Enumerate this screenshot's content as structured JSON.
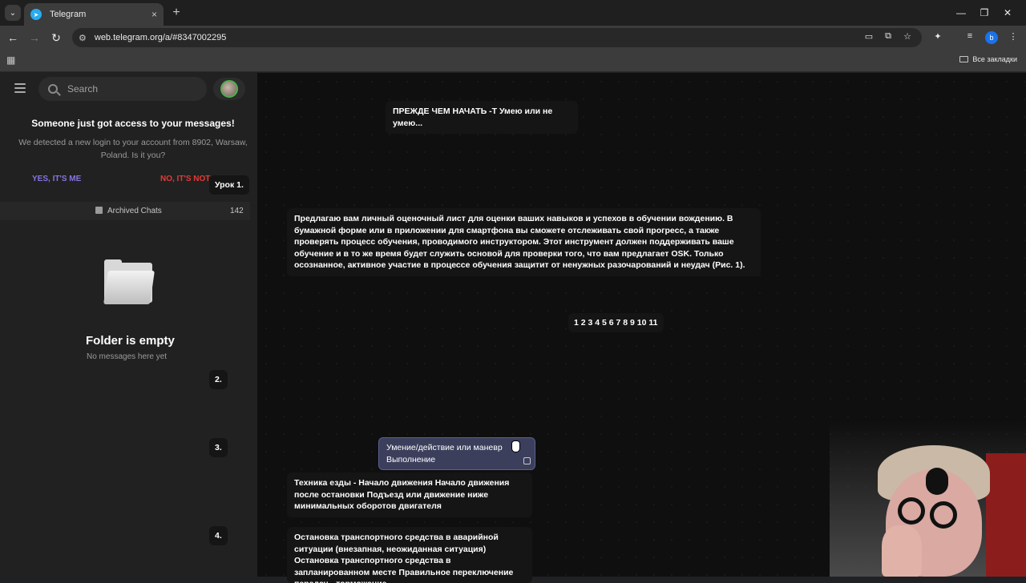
{
  "browser": {
    "tab_title": "Telegram",
    "tab_close": "×",
    "new_tab": "+",
    "url": "web.telegram.org/a/#8347002295",
    "profile_initial": "b",
    "bookmarks_all": "Все закладки",
    "window_controls": [
      "—",
      "❐",
      "✕"
    ]
  },
  "sidebar": {
    "search_placeholder": "Search",
    "alert_title": "Someone just got access to your messages!",
    "alert_body": "We detected a new login to your account from 8902, Warsaw, Poland. Is it you?",
    "yes_label": "YES, IT'S ME",
    "no_label": "NO, IT'S NOT",
    "archived_label": "Archived Chats",
    "archived_count": "142",
    "empty_title": "Folder is empty",
    "empty_sub": "No messages here yet"
  },
  "chat": {
    "msg_start": "ПРЕЖДЕ ЧЕМ НАЧАТЬ -Т Умею или не умею...",
    "lesson1": "Урок 1.",
    "msg_intro": "Предлагаю вам личный оценочный лист для оценки ваших навыков и успехов в обучении вождению. В бумажной форме или в приложении для смартфона вы сможете отслеживать свой прогресс, а также проверять процесс обучения, проводимого инструктором. Этот инструмент должен поддерживать ваше обучение и в то же время будет служить основой для проверки того, что вам предлагает OSK. Только осознанное, активное участие в процессе обучения защитит от ненужных разочарований и неудач (Рис. 1).",
    "numbers": "1 2 3 4 5 6 7 8 9 10 11",
    "label2": "2.",
    "label3": "3.",
    "label4": "4.",
    "highlight_line1": "Умение/действие или маневр",
    "highlight_line2": "Выполнение",
    "msg_technique": "Техника езды - Начало движения Начало движения после остановки Подъезд или движение ниже минимальных оборотов двигателя",
    "msg_stop": "Остановка транспортного средства в аварийной ситуации (внезапная, неожиданная ситуация) Остановка транспортного средства в запланированном месте Правильное переключение передач - торможение"
  }
}
